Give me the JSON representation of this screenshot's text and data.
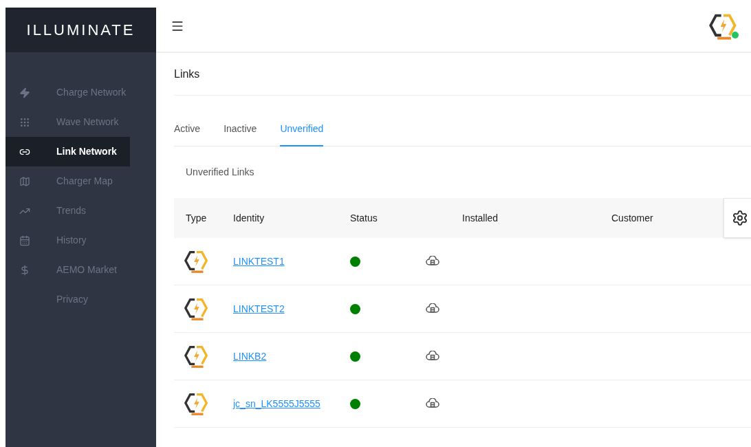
{
  "brand": "ILLUMINATE",
  "sidebar": {
    "items": [
      {
        "label": "Charge Network",
        "selected": false
      },
      {
        "label": "Wave Network",
        "selected": false
      },
      {
        "label": "Link Network",
        "selected": true
      },
      {
        "label": "Charger Map",
        "selected": false
      },
      {
        "label": "Trends",
        "selected": false
      },
      {
        "label": "History",
        "selected": false
      },
      {
        "label": "AEMO Market",
        "selected": false
      },
      {
        "label": "Privacy",
        "selected": false
      }
    ]
  },
  "page_title": "Links",
  "tabs": [
    {
      "label": "Active",
      "selected": false
    },
    {
      "label": "Inactive",
      "selected": false
    },
    {
      "label": "Unverified",
      "selected": true
    }
  ],
  "table": {
    "title": "Unverified Links",
    "columns": [
      "Type",
      "Identity",
      "Status",
      "Installed",
      "Customer"
    ],
    "rows": [
      {
        "identity": "LINKTEST1",
        "color": "#008000"
      },
      {
        "identity": "LINKTEST2",
        "color": "#008000"
      },
      {
        "identity": "LINKB2",
        "color": "#008000"
      },
      {
        "identity": "jc_sn_LK5555J5555",
        "color": "#008000"
      }
    ]
  }
}
